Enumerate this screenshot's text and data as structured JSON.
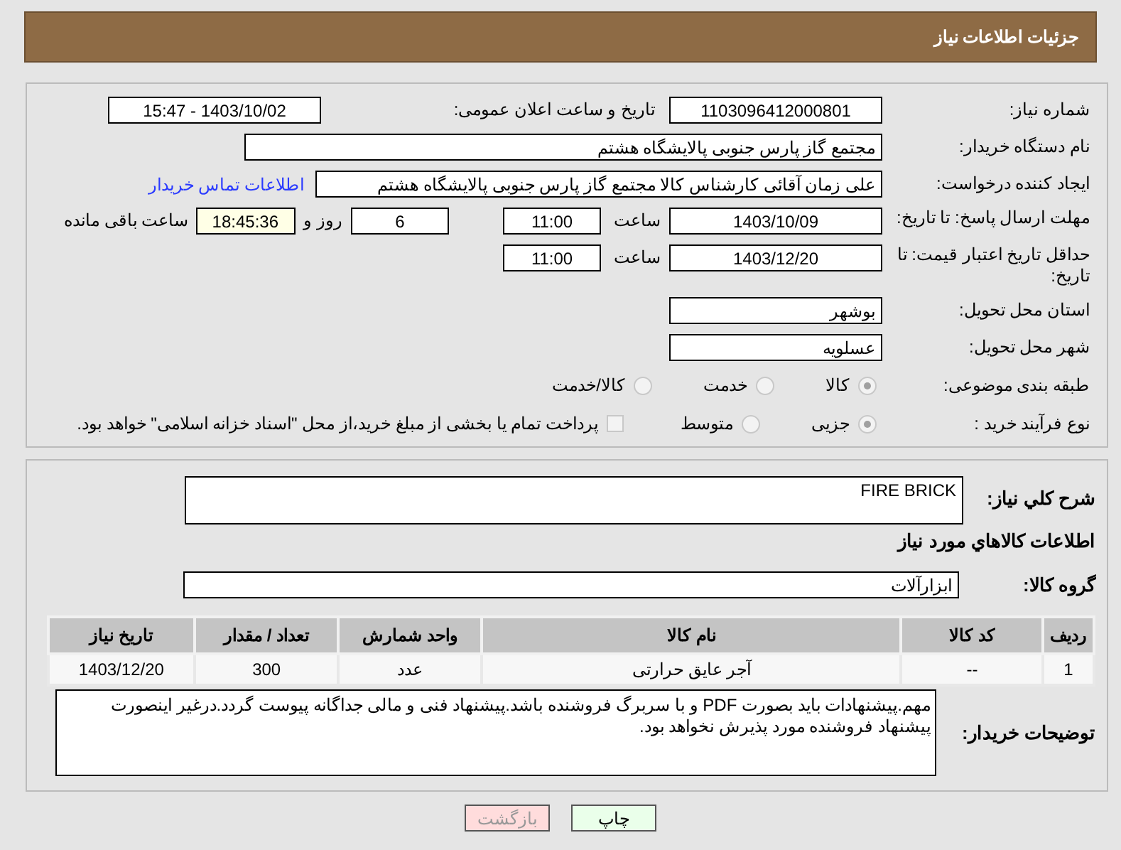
{
  "header": {
    "title": "جزئیات اطلاعات نیاز"
  },
  "need_number": {
    "label": "شماره نیاز:",
    "value": "1103096412000801"
  },
  "announce": {
    "label": "تاریخ و ساعت اعلان عمومی:",
    "value": "1403/10/02 - 15:47"
  },
  "buyer": {
    "label": "نام دستگاه خریدار:",
    "value": "مجتمع گاز پارس جنوبی  پالایشگاه هشتم"
  },
  "creator": {
    "label": "ایجاد کننده درخواست:",
    "value": "علی زمان آقائی کارشناس کالا مجتمع گاز پارس جنوبی  پالایشگاه هشتم",
    "link": "اطلاعات تماس خریدار"
  },
  "deadline": {
    "label": "مهلت ارسال پاسخ: تا تاریخ:",
    "date": "1403/10/09",
    "time_label": "ساعت",
    "time": "11:00",
    "days": "6",
    "days_label": "روز و",
    "remaining": "18:45:36",
    "remaining_label": "ساعت باقی مانده"
  },
  "validity": {
    "label": "حداقل تاریخ اعتبار قیمت: تا تاریخ:",
    "date": "1403/12/20",
    "time_label": "ساعت",
    "time": "11:00"
  },
  "province": {
    "label": "استان محل تحویل:",
    "value": "بوشهر"
  },
  "city": {
    "label": "شهر محل تحویل:",
    "value": "عسلویه"
  },
  "category": {
    "label": "طبقه بندی موضوعی:",
    "options": [
      {
        "label": "کالا",
        "selected": true
      },
      {
        "label": "خدمت",
        "selected": false
      },
      {
        "label": "کالا/خدمت",
        "selected": false
      }
    ]
  },
  "process": {
    "label": "نوع فرآیند خرید :",
    "options": [
      {
        "label": "جزیی",
        "selected": true
      },
      {
        "label": "متوسط",
        "selected": false
      }
    ],
    "payment": {
      "checked": false,
      "label": "پرداخت تمام یا بخشی از مبلغ خرید،از محل \"اسناد خزانه اسلامی\" خواهد بود."
    }
  },
  "summary": {
    "label": "شرح کلي نياز:",
    "value": "FIRE BRICK"
  },
  "items_heading": "اطلاعات کالاهاي مورد نياز",
  "goods_group": {
    "label": "گروه کالا:",
    "value": "ابزارآلات"
  },
  "table": {
    "columns": [
      "رديف",
      "کد کالا",
      "نام کالا",
      "واحد شمارش",
      "تعداد / مقدار",
      "تاريخ نياز"
    ],
    "rows": [
      [
        "1",
        "--",
        "آجر عایق حرارتی",
        "عدد",
        "300",
        "1403/12/20"
      ]
    ]
  },
  "notes": {
    "label": "توضیحات خریدار:",
    "value": "مهم.پیشنهادات باید بصورت PDF و با سربرگ فروشنده باشد.پیشنهاد فنی و مالی جداگانه پیوست گردد.درغیر اینصورت پیشنهاد فروشنده مورد پذیرش نخواهد بود."
  },
  "buttons": [
    {
      "label": "چاپ",
      "kind": "print"
    },
    {
      "label": "بازگشت",
      "kind": "back"
    }
  ]
}
